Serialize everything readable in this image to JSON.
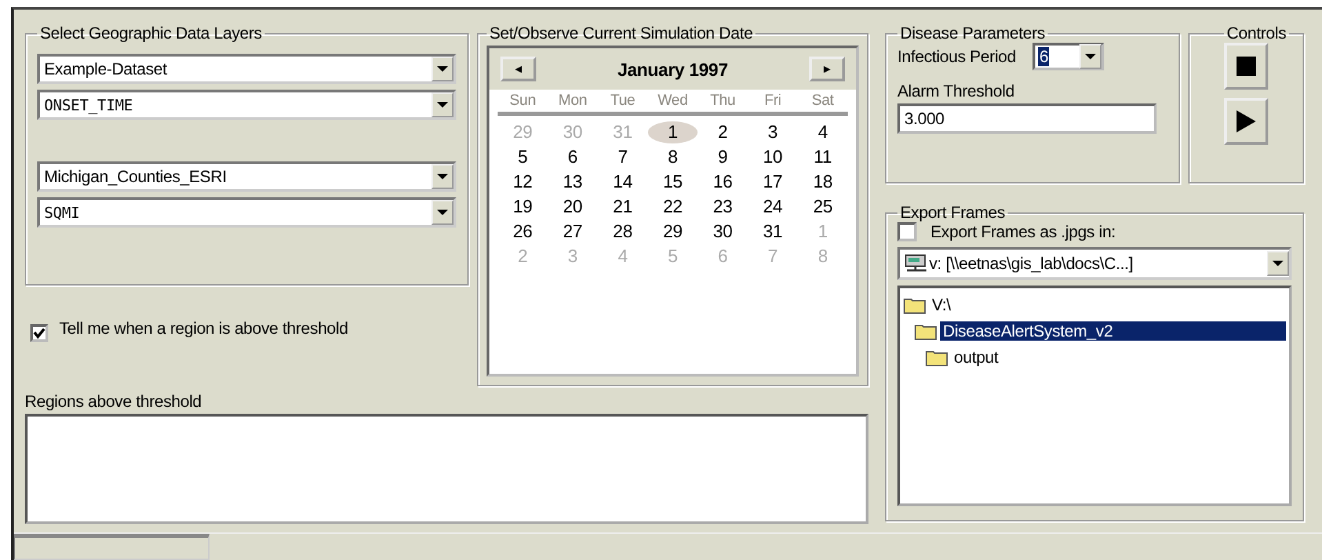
{
  "layers": {
    "title": "Select Geographic Data Layers",
    "dropdowns": [
      {
        "value": "Example-Dataset",
        "kind": "text"
      },
      {
        "value": "ONSET_TIME",
        "kind": "mono"
      },
      {
        "value": "Michigan_Counties_ESRI",
        "kind": "text"
      },
      {
        "value": "SQMI",
        "kind": "mono"
      }
    ]
  },
  "alert_checkbox": {
    "label": "Tell me when a region is above threshold",
    "checked": true
  },
  "regions": {
    "label": "Regions above threshold"
  },
  "calendar": {
    "title": "Set/Observe Current Simulation Date",
    "prev": "◂",
    "next": "▸",
    "month": "January 1997",
    "weekdays": [
      "Sun",
      "Mon",
      "Tue",
      "Wed",
      "Thu",
      "Fri",
      "Sat"
    ],
    "weeks": [
      [
        {
          "text": "29",
          "other": true,
          "selected": false
        },
        {
          "text": "30",
          "other": true,
          "selected": false
        },
        {
          "text": "31",
          "other": true,
          "selected": false
        },
        {
          "text": "1",
          "other": false,
          "selected": true
        },
        {
          "text": "2",
          "other": false,
          "selected": false
        },
        {
          "text": "3",
          "other": false,
          "selected": false
        },
        {
          "text": "4",
          "other": false,
          "selected": false
        }
      ],
      [
        {
          "text": "5",
          "other": false,
          "selected": false
        },
        {
          "text": "6",
          "other": false,
          "selected": false
        },
        {
          "text": "7",
          "other": false,
          "selected": false
        },
        {
          "text": "8",
          "other": false,
          "selected": false
        },
        {
          "text": "9",
          "other": false,
          "selected": false
        },
        {
          "text": "10",
          "other": false,
          "selected": false
        },
        {
          "text": "11",
          "other": false,
          "selected": false
        }
      ],
      [
        {
          "text": "12",
          "other": false,
          "selected": false
        },
        {
          "text": "13",
          "other": false,
          "selected": false
        },
        {
          "text": "14",
          "other": false,
          "selected": false
        },
        {
          "text": "15",
          "other": false,
          "selected": false
        },
        {
          "text": "16",
          "other": false,
          "selected": false
        },
        {
          "text": "17",
          "other": false,
          "selected": false
        },
        {
          "text": "18",
          "other": false,
          "selected": false
        }
      ],
      [
        {
          "text": "19",
          "other": false,
          "selected": false
        },
        {
          "text": "20",
          "other": false,
          "selected": false
        },
        {
          "text": "21",
          "other": false,
          "selected": false
        },
        {
          "text": "22",
          "other": false,
          "selected": false
        },
        {
          "text": "23",
          "other": false,
          "selected": false
        },
        {
          "text": "24",
          "other": false,
          "selected": false
        },
        {
          "text": "25",
          "other": false,
          "selected": false
        }
      ],
      [
        {
          "text": "26",
          "other": false,
          "selected": false
        },
        {
          "text": "27",
          "other": false,
          "selected": false
        },
        {
          "text": "28",
          "other": false,
          "selected": false
        },
        {
          "text": "29",
          "other": false,
          "selected": false
        },
        {
          "text": "30",
          "other": false,
          "selected": false
        },
        {
          "text": "31",
          "other": false,
          "selected": false
        },
        {
          "text": "1",
          "other": true,
          "selected": false
        }
      ],
      [
        {
          "text": "2",
          "other": true,
          "selected": false
        },
        {
          "text": "3",
          "other": true,
          "selected": false
        },
        {
          "text": "4",
          "other": true,
          "selected": false
        },
        {
          "text": "5",
          "other": true,
          "selected": false
        },
        {
          "text": "6",
          "other": true,
          "selected": false
        },
        {
          "text": "7",
          "other": true,
          "selected": false
        },
        {
          "text": "8",
          "other": true,
          "selected": false
        }
      ]
    ]
  },
  "disease": {
    "title": "Disease Parameters",
    "period_label": "Infectious Period",
    "period_value": "6",
    "threshold_label": "Alarm Threshold",
    "threshold_value": "3.000"
  },
  "controls": {
    "title": "Controls",
    "buttons": [
      {
        "kind": "stop"
      },
      {
        "kind": "play"
      }
    ]
  },
  "export": {
    "title": "Export Frames",
    "checkbox": {
      "label": "Export Frames as .jpgs in:",
      "checked": false
    },
    "drive": "v: [\\\\eetnas\\gis_lab\\docs\\C...]",
    "tree": [
      {
        "label": "V:\\",
        "selected": false,
        "children": [
          {
            "label": "DiseaseAlertSystem_v2",
            "selected": true,
            "children": [
              {
                "label": "output",
                "selected": false
              }
            ]
          }
        ]
      }
    ]
  }
}
